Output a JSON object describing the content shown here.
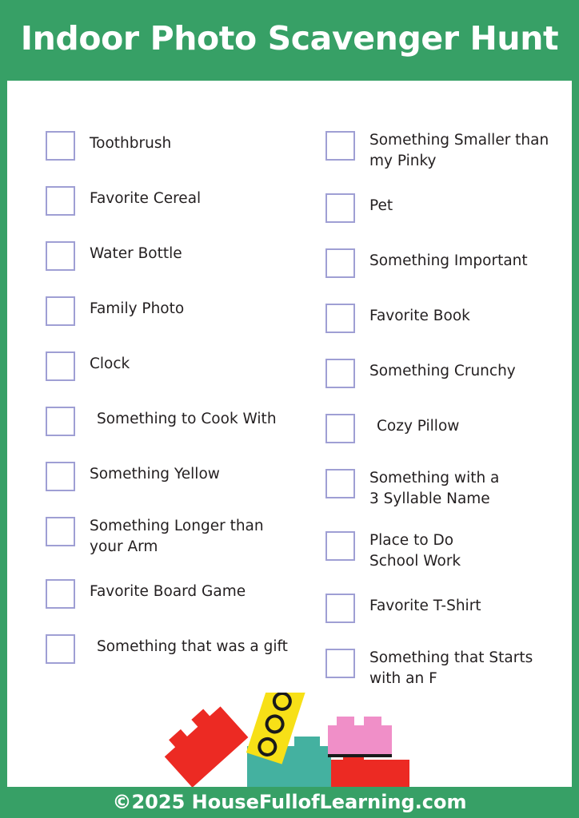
{
  "header": {
    "title": "Indoor Photo Scavenger Hunt"
  },
  "footer": {
    "copyright": "©2025 HouseFullofLearning.com"
  },
  "colors": {
    "brand_green": "#37a066",
    "checkbox_border": "#9f9fd4",
    "text": "#231f20",
    "brick_yellow": "#f7e017",
    "brick_red": "#ec2a23",
    "brick_pink": "#f08fc8",
    "brick_teal": "#44b1a0",
    "brick_stud_outline": "#1a1a1a"
  },
  "checklist": {
    "left_column": [
      {
        "label": "Toothbrush",
        "indented": false,
        "lines": 1
      },
      {
        "label": "Favorite Cereal",
        "indented": false,
        "lines": 1
      },
      {
        "label": "Water Bottle",
        "indented": false,
        "lines": 1
      },
      {
        "label": "Family Photo",
        "indented": false,
        "lines": 1
      },
      {
        "label": "Clock",
        "indented": false,
        "lines": 1
      },
      {
        "label": "Something to Cook With",
        "indented": true,
        "lines": 1
      },
      {
        "label": "Something Yellow",
        "indented": false,
        "lines": 1
      },
      {
        "label": "Something Longer than\nyour Arm",
        "indented": false,
        "lines": 2
      },
      {
        "label": "Favorite Board Game",
        "indented": false,
        "lines": 1
      },
      {
        "label": "Something that was a gift",
        "indented": true,
        "lines": 1
      }
    ],
    "right_column": [
      {
        "label": "Something Smaller than\nmy Pinky",
        "indented": false,
        "lines": 2
      },
      {
        "label": "Pet",
        "indented": false,
        "lines": 1
      },
      {
        "label": "Something Important",
        "indented": false,
        "lines": 1
      },
      {
        "label": "Favorite Book",
        "indented": false,
        "lines": 1
      },
      {
        "label": "Something Crunchy",
        "indented": false,
        "lines": 1
      },
      {
        "label": "Cozy Pillow",
        "indented": true,
        "lines": 1
      },
      {
        "label": "Something with a\n3 Syllable Name",
        "indented": false,
        "lines": 2
      },
      {
        "label": "Place to Do\nSchool Work",
        "indented": false,
        "lines": 2
      },
      {
        "label": "Favorite T-Shirt",
        "indented": false,
        "lines": 1
      },
      {
        "label": "Something that Starts\nwith an F",
        "indented": false,
        "lines": 2
      }
    ]
  }
}
